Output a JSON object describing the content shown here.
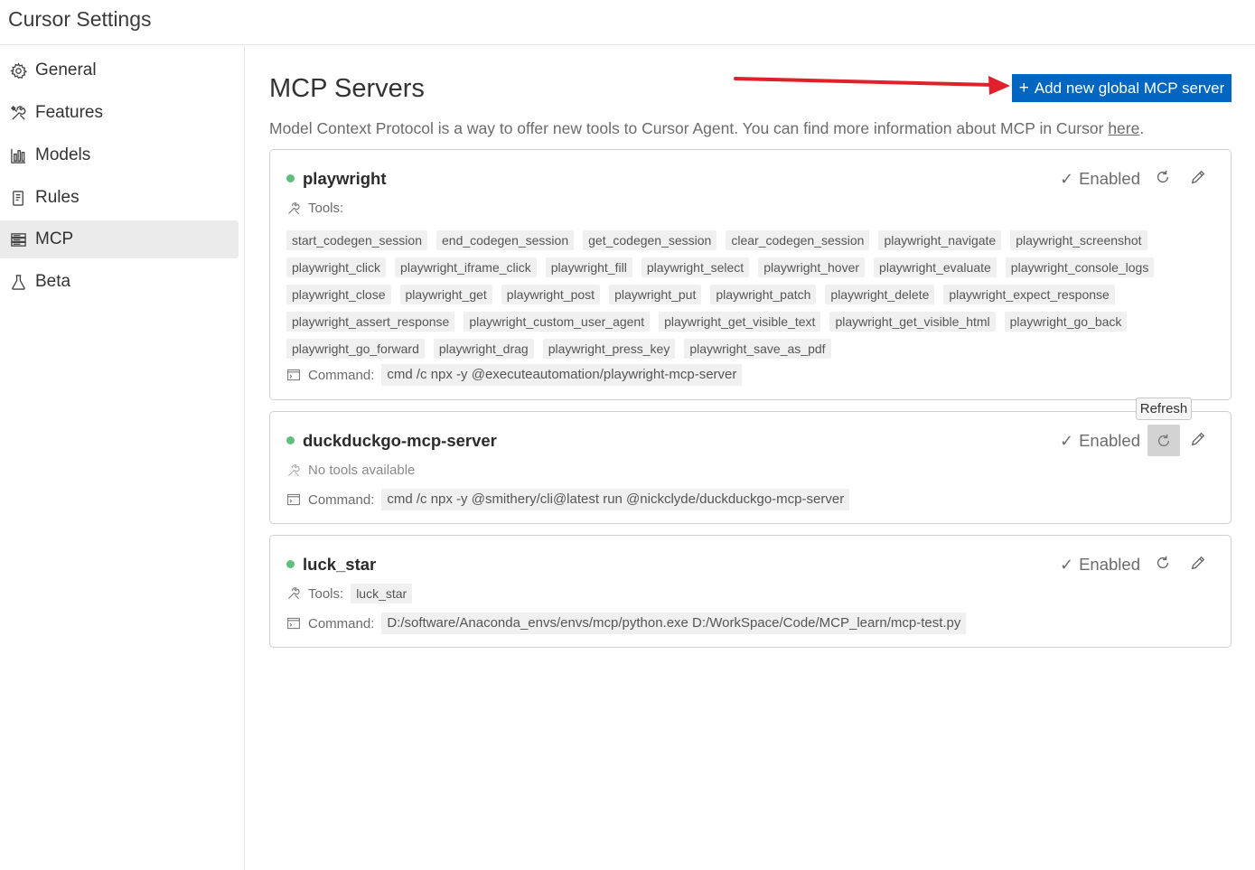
{
  "app": {
    "title": "Cursor Settings"
  },
  "sidebar": {
    "items": [
      {
        "label": "General",
        "icon": "gear-icon"
      },
      {
        "label": "Features",
        "icon": "tools-icon"
      },
      {
        "label": "Models",
        "icon": "bar-chart-icon"
      },
      {
        "label": "Rules",
        "icon": "document-icon"
      },
      {
        "label": "MCP",
        "icon": "server-icon",
        "active": true
      },
      {
        "label": "Beta",
        "icon": "flask-icon"
      }
    ]
  },
  "main": {
    "title": "MCP Servers",
    "add_button_label": "Add new global MCP server",
    "description": "Model Context Protocol is a way to offer new tools to Cursor Agent. You can find more information about MCP in Cursor ",
    "description_link": "here",
    "description_end": "."
  },
  "tooltip": {
    "text": "Refresh"
  },
  "servers": [
    {
      "name": "playwright",
      "status": "Enabled",
      "tools_label": "Tools:",
      "tools": [
        "start_codegen_session",
        "end_codegen_session",
        "get_codegen_session",
        "clear_codegen_session",
        "playwright_navigate",
        "playwright_screenshot",
        "playwright_click",
        "playwright_iframe_click",
        "playwright_fill",
        "playwright_select",
        "playwright_hover",
        "playwright_evaluate",
        "playwright_console_logs",
        "playwright_close",
        "playwright_get",
        "playwright_post",
        "playwright_put",
        "playwright_patch",
        "playwright_delete",
        "playwright_expect_response",
        "playwright_assert_response",
        "playwright_custom_user_agent",
        "playwright_get_visible_text",
        "playwright_get_visible_html",
        "playwright_go_back",
        "playwright_go_forward",
        "playwright_drag",
        "playwright_press_key",
        "playwright_save_as_pdf"
      ],
      "command_label": "Command:",
      "command": "cmd /c npx -y @executeautomation/playwright-mcp-server"
    },
    {
      "name": "duckduckgo-mcp-server",
      "status": "Enabled",
      "tools_text": "No tools available",
      "command_label": "Command:",
      "command": "cmd /c npx -y @smithery/cli@latest run @nickclyde/duckduckgo-mcp-server"
    },
    {
      "name": "luck_star",
      "status": "Enabled",
      "tools_label": "Tools:",
      "tools": [
        "luck_star"
      ],
      "command_label": "Command:",
      "command": "D:/software/Anaconda_envs/envs/mcp/python.exe D:/WorkSpace/Code/MCP_learn/mcp-test.py"
    }
  ],
  "colors": {
    "accent": "#0066c0",
    "status_enabled": "#5fbf7d",
    "annotation_arrow": "#e0202a"
  }
}
